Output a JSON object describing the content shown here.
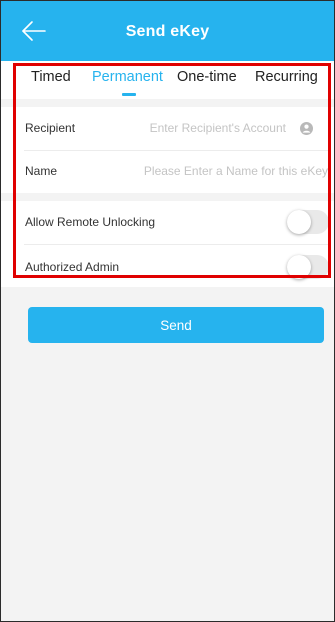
{
  "header": {
    "title": "Send eKey",
    "back_icon": "arrow-left-icon"
  },
  "tabs": [
    {
      "label": "Timed",
      "active": false
    },
    {
      "label": "Permanent",
      "active": true
    },
    {
      "label": "One-time",
      "active": false
    },
    {
      "label": "Recurring",
      "active": false
    }
  ],
  "form": {
    "recipient": {
      "label": "Recipient",
      "value": "",
      "placeholder": "Enter Recipient's Account",
      "icon": "info-icon"
    },
    "name": {
      "label": "Name",
      "value": "",
      "placeholder": "Please Enter a Name for this eKey"
    },
    "allow_remote_unlocking": {
      "label": "Allow Remote Unlocking",
      "enabled": false
    },
    "authorized_admin": {
      "label": "Authorized Admin",
      "enabled": false
    }
  },
  "send_button": {
    "label": "Send"
  },
  "colors": {
    "accent": "#26b3ee",
    "highlight": "#e00000",
    "background": "#f3f3f3"
  }
}
